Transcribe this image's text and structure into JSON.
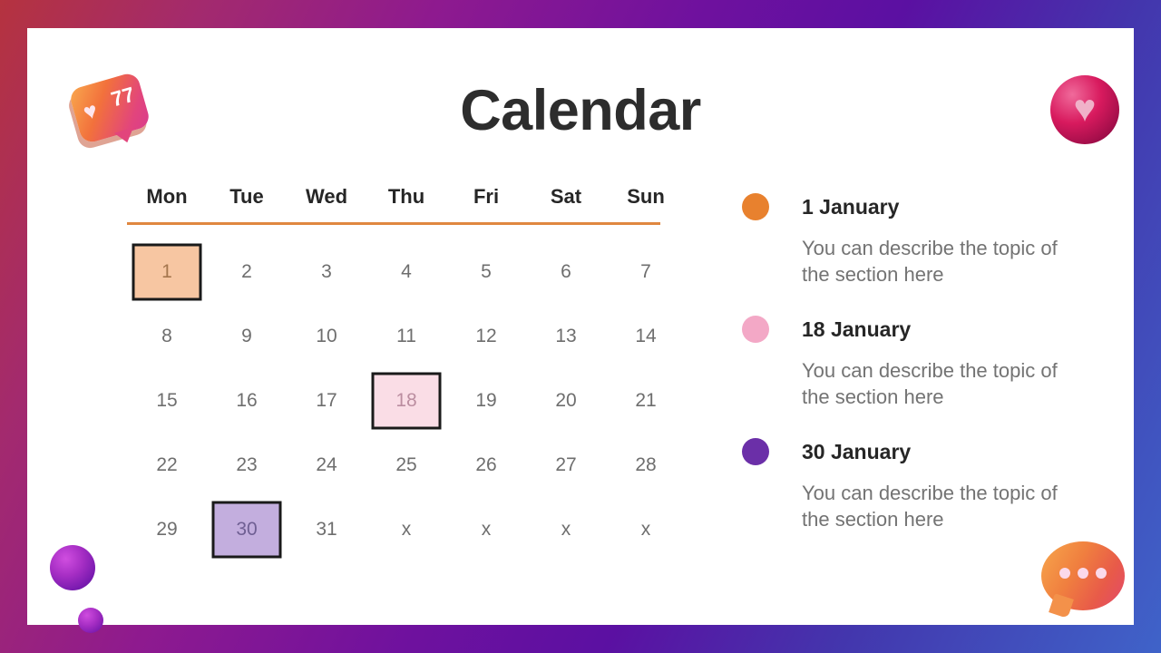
{
  "slide": {
    "title": "Calendar",
    "background_gradient": [
      "#b5333f",
      "#8e1a8f",
      "#5b10a2",
      "#3f63c9"
    ],
    "card_background": "#ffffff"
  },
  "calendar": {
    "weekdays": [
      "Mon",
      "Tue",
      "Wed",
      "Thu",
      "Fri",
      "Sat",
      "Sun"
    ],
    "divider_color": "#e08740",
    "empty_marker": "x",
    "weeks": [
      [
        {
          "label": "1",
          "highlight": "orange"
        },
        {
          "label": "2",
          "highlight": null
        },
        {
          "label": "3",
          "highlight": null
        },
        {
          "label": "4",
          "highlight": null
        },
        {
          "label": "5",
          "highlight": null
        },
        {
          "label": "6",
          "highlight": null
        },
        {
          "label": "7",
          "highlight": null
        }
      ],
      [
        {
          "label": "8",
          "highlight": null
        },
        {
          "label": "9",
          "highlight": null
        },
        {
          "label": "10",
          "highlight": null
        },
        {
          "label": "11",
          "highlight": null
        },
        {
          "label": "12",
          "highlight": null
        },
        {
          "label": "13",
          "highlight": null
        },
        {
          "label": "14",
          "highlight": null
        }
      ],
      [
        {
          "label": "15",
          "highlight": null
        },
        {
          "label": "16",
          "highlight": null
        },
        {
          "label": "17",
          "highlight": null
        },
        {
          "label": "18",
          "highlight": "pink"
        },
        {
          "label": "19",
          "highlight": null
        },
        {
          "label": "20",
          "highlight": null
        },
        {
          "label": "21",
          "highlight": null
        }
      ],
      [
        {
          "label": "22",
          "highlight": null
        },
        {
          "label": "23",
          "highlight": null
        },
        {
          "label": "24",
          "highlight": null
        },
        {
          "label": "25",
          "highlight": null
        },
        {
          "label": "26",
          "highlight": null
        },
        {
          "label": "27",
          "highlight": null
        },
        {
          "label": "28",
          "highlight": null
        }
      ],
      [
        {
          "label": "29",
          "highlight": null
        },
        {
          "label": "30",
          "highlight": "purple"
        },
        {
          "label": "31",
          "highlight": null
        },
        {
          "label": "x",
          "highlight": null
        },
        {
          "label": "x",
          "highlight": null
        },
        {
          "label": "x",
          "highlight": null
        },
        {
          "label": "x",
          "highlight": null
        }
      ]
    ],
    "highlight_colors": {
      "orange": "#f7c6a2",
      "pink": "#fadde6",
      "purple": "#c3aede"
    }
  },
  "legend": {
    "items": [
      {
        "dot_color": "#e8812e",
        "title": "1 January",
        "description": "You can describe the topic of the section here"
      },
      {
        "dot_color": "#f3a8c6",
        "title": "18 January",
        "description": "You can describe the topic of the section here"
      },
      {
        "dot_color": "#6b2fa8",
        "title": "30 January",
        "description": "You can describe the topic of the section here"
      }
    ]
  },
  "decorations": {
    "like_bubble": {
      "count": "77",
      "heart_glyph": "♥"
    },
    "heart_sphere": {
      "heart_glyph": "♥",
      "color": "#d81a5e"
    },
    "sphere_big_color": "#a62ec4",
    "sphere_small_color": "#a52dc3",
    "chat_bubble_color": "#f07f3f"
  }
}
